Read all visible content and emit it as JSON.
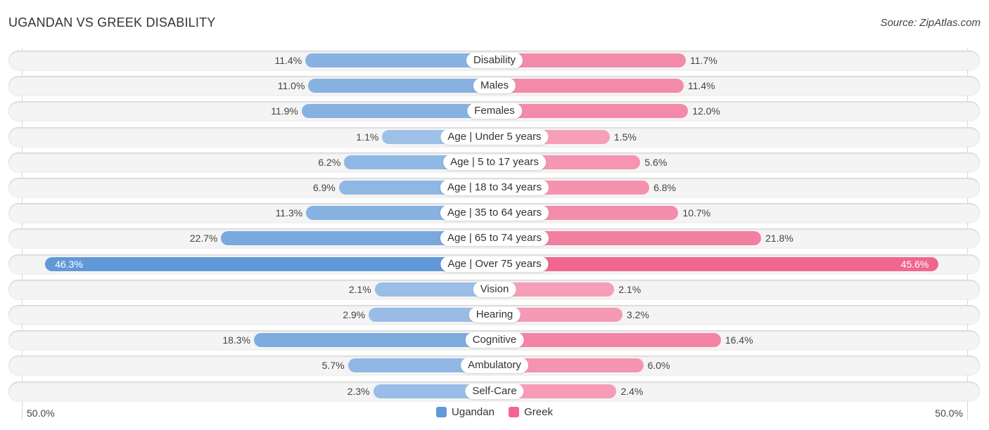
{
  "header": {
    "title": "UGANDAN VS GREEK DISABILITY",
    "source": "Source: ZipAtlas.com"
  },
  "chart_data": {
    "type": "bar",
    "orientation": "horizontal-diverging",
    "title": "UGANDAN VS GREEK DISABILITY",
    "categories": [
      "Disability",
      "Males",
      "Females",
      "Age | Under 5 years",
      "Age | 5 to 17 years",
      "Age | 18 to 34 years",
      "Age | 35 to 64 years",
      "Age | 65 to 74 years",
      "Age | Over 75 years",
      "Vision",
      "Hearing",
      "Cognitive",
      "Ambulatory",
      "Self-Care"
    ],
    "series": [
      {
        "name": "Ugandan",
        "color": "#6199d8",
        "values": [
          11.4,
          11.0,
          11.9,
          1.1,
          6.2,
          6.9,
          11.3,
          22.7,
          46.3,
          2.1,
          2.9,
          18.3,
          5.7,
          2.3
        ],
        "labels": [
          "11.4%",
          "11.0%",
          "11.9%",
          "1.1%",
          "6.2%",
          "6.9%",
          "11.3%",
          "22.7%",
          "46.3%",
          "2.1%",
          "2.9%",
          "18.3%",
          "5.7%",
          "2.3%"
        ]
      },
      {
        "name": "Greek",
        "color": "#f0668f",
        "values": [
          11.7,
          11.4,
          12.0,
          1.5,
          5.6,
          6.8,
          10.7,
          21.8,
          45.6,
          2.1,
          3.2,
          16.4,
          6.0,
          2.4
        ],
        "labels": [
          "11.7%",
          "11.4%",
          "12.0%",
          "1.5%",
          "5.6%",
          "6.8%",
          "10.7%",
          "21.8%",
          "45.6%",
          "2.1%",
          "3.2%",
          "16.4%",
          "6.0%",
          "2.4%"
        ]
      }
    ],
    "xlim": [
      -50,
      50
    ],
    "axis_labels": {
      "left": "50.0%",
      "right": "50.0%"
    },
    "legend": {
      "position": "bottom-center",
      "entries": [
        "Ugandan",
        "Greek"
      ]
    },
    "grid": false
  }
}
